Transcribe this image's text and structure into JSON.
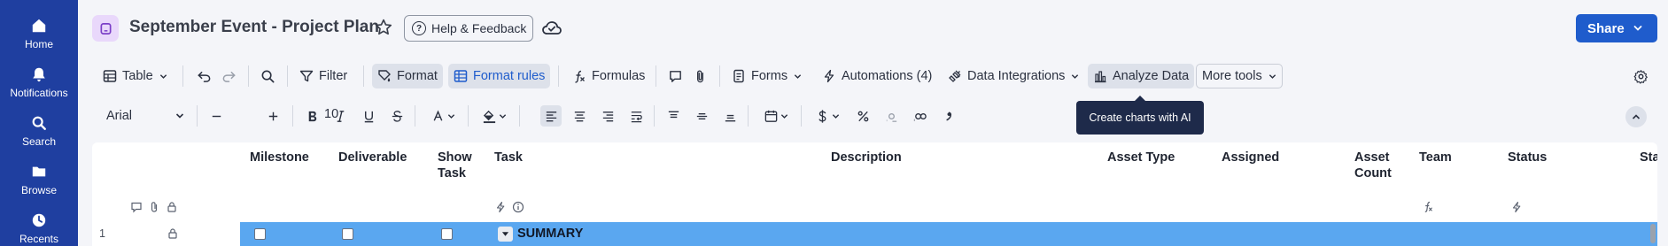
{
  "nav": {
    "items": [
      {
        "label": "Home",
        "icon": "home-icon"
      },
      {
        "label": "Notifications",
        "icon": "bell-icon"
      },
      {
        "label": "Search",
        "icon": "search-icon"
      },
      {
        "label": "Browse",
        "icon": "folder-icon"
      },
      {
        "label": "Recents",
        "icon": "clock-icon"
      }
    ]
  },
  "header": {
    "title": "September Event - Project Plan",
    "help_label": "Help & Feedback",
    "share_label": "Share"
  },
  "toolbar": {
    "view_label": "Table",
    "filter_label": "Filter",
    "format_label": "Format",
    "format_rules_label": "Format rules",
    "formulas_label": "Formulas",
    "forms_label": "Forms",
    "automations_label": "Automations (4)",
    "data_integrations_label": "Data Integrations",
    "analyze_label": "Analyze Data",
    "more_tools_label": "More tools"
  },
  "format_bar": {
    "font": "Arial",
    "font_size": "10"
  },
  "tooltip": {
    "text": "Create charts with AI"
  },
  "grid": {
    "columns": [
      {
        "label": "Milestone"
      },
      {
        "label": "Deliverable"
      },
      {
        "label": "Show Task"
      },
      {
        "label": "Task"
      },
      {
        "label": "Description"
      },
      {
        "label": "Asset Type"
      },
      {
        "label": "Assigned"
      },
      {
        "label": "Asset Count"
      },
      {
        "label": "Team"
      },
      {
        "label": "Status"
      },
      {
        "label": "Sta"
      }
    ],
    "rows": [
      {
        "number": "1",
        "task": "SUMMARY"
      }
    ]
  },
  "colors": {
    "nav_bg": "#1f3fa0",
    "accent": "#1f5ccc",
    "summary_row": "#5aa7f0",
    "tooltip_bg": "#1e2a4a"
  }
}
